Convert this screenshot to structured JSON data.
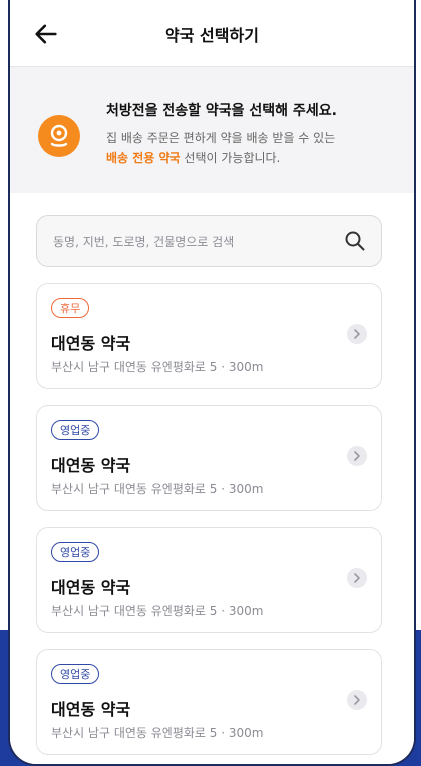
{
  "header": {
    "title": "약국 선택하기"
  },
  "notice": {
    "title": "처방전을 전송할 약국을 선택해 주세요.",
    "line1": "집 배송 주문은 편하게 약을 배송 받을 수 있는",
    "line2_highlight": "배송 전용 약국",
    "line2_rest": " 선택이 가능합니다."
  },
  "search": {
    "placeholder": "동명, 지번, 도로명, 건물명으로 검색"
  },
  "pharmacies": [
    {
      "status": "휴무",
      "name": "대연동 약국",
      "address": "부산시 남구 대연동 유엔평화로 5 · 300m"
    },
    {
      "status": "영업중",
      "name": "대연동 약국",
      "address": "부산시 남구 대연동 유엔평화로 5 · 300m"
    },
    {
      "status": "영업중",
      "name": "대연동 약국",
      "address": "부산시 남구 대연동 유엔평화로 5 · 300m"
    },
    {
      "status": "영업중",
      "name": "대연동 약국",
      "address": "부산시 남구 대연동 유엔평화로 5 · 300m"
    }
  ],
  "colors": {
    "accent": "#f07a13",
    "brand": "#2f49a6",
    "closed": "#ec6a3a"
  },
  "icons": {
    "back": "arrow-left-icon",
    "search": "search-icon",
    "pin": "location-pin-icon",
    "chevron": "chevron-right-icon"
  }
}
